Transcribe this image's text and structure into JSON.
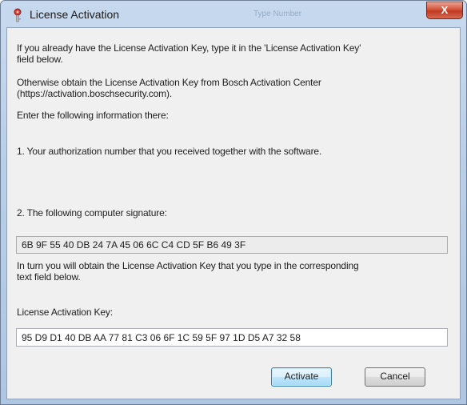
{
  "window": {
    "title": "License Activation",
    "background_title": "Type Number",
    "close_glyph": "X"
  },
  "dialog": {
    "intro_line1": "If you already have the License Activation Key, type it in the 'License Activation Key'",
    "intro_line2": "field below.",
    "obtain_line1": "Otherwise obtain the License Activation Key from Bosch Activation Center",
    "obtain_line2": "(https://activation.boschsecurity.com).",
    "enter_info": "Enter the following information there:",
    "step1": "1. Your authorization number that you received together with the software.",
    "step2": "2. The following computer signature:",
    "signature_value": "6B 9F 55 40 DB 24 7A 45 06 6C C4 CD 5F B6 49 3F",
    "in_turn_line1": "In turn you will obtain the License Activation Key that you type in the corresponding",
    "in_turn_line2": "text field below.",
    "key_label": "License Activation Key:",
    "key_value": "95 D9 D1 40 DB AA 77 81 C3 06 6F 1C 59 5F 97 1D D5 A7 32 58"
  },
  "buttons": {
    "activate": "Activate",
    "cancel": "Cancel"
  },
  "icons": {
    "title_icon": "activation-key-icon",
    "close_icon": "close-icon"
  },
  "colors": {
    "close_button": "#c23a22",
    "activate_border": "#3c7fb1"
  }
}
